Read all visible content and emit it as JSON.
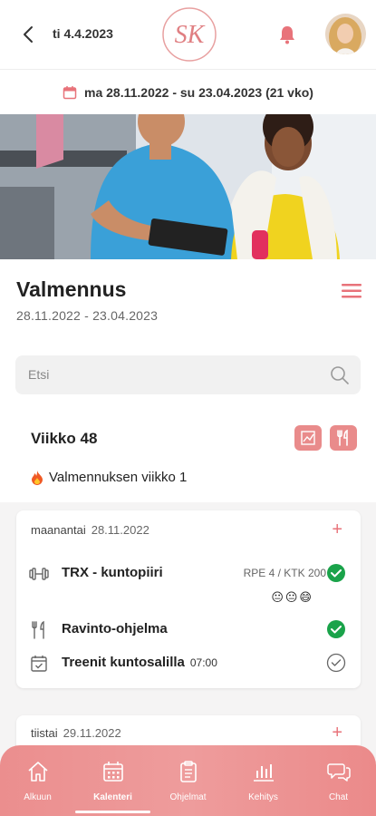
{
  "header": {
    "date_label": "ti 4.4.2023",
    "logo_text": "SK"
  },
  "range_bar": {
    "text": "ma 28.11.2022 - su 23.04.2023 (21 vko)"
  },
  "main": {
    "title": "Valmennus",
    "subtitle": "28.11.2022 - 23.04.2023"
  },
  "search": {
    "placeholder": "Etsi"
  },
  "week": {
    "title": "Viikko 48",
    "coach_week": "Valmennuksen viikko 1"
  },
  "days": [
    {
      "weekday": "maanantai",
      "date": "28.11.2022",
      "items": [
        {
          "label": "TRX - kuntopiiri",
          "meta": "RPE 4 / KTK 200",
          "emojis": "😐😐😄",
          "status": "done"
        },
        {
          "label": "Ravinto-ohjelma",
          "status": "done"
        },
        {
          "label": "Treenit kuntosalilla",
          "time": "07:00",
          "status": "pending"
        }
      ]
    },
    {
      "weekday": "tiistai",
      "date": "29.11.2022"
    }
  ],
  "bottom_nav": [
    {
      "label": "Alkuun",
      "icon": "home-icon"
    },
    {
      "label": "Kalenteri",
      "icon": "calendar-icon",
      "active": true
    },
    {
      "label": "Ohjelmat",
      "icon": "clipboard-icon"
    },
    {
      "label": "Kehitys",
      "icon": "bar-chart-icon"
    },
    {
      "label": "Chat",
      "icon": "chat-icon"
    }
  ],
  "colors": {
    "accent": "#e8737a",
    "accent_light": "#e98b8b",
    "success": "#1aa34a"
  }
}
